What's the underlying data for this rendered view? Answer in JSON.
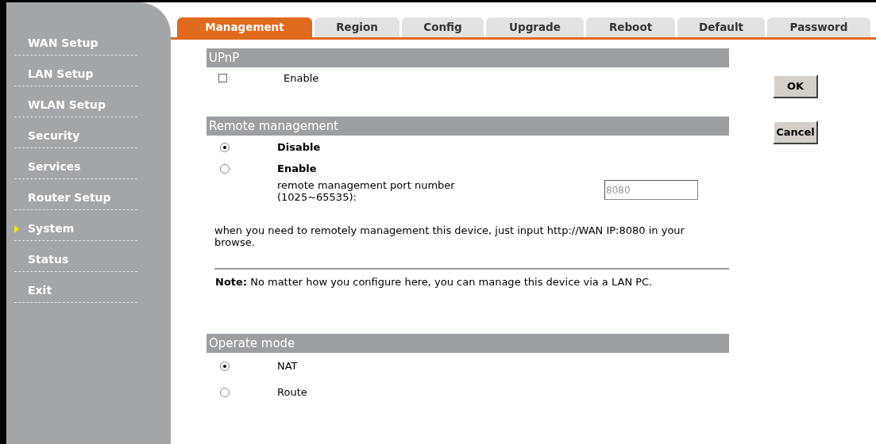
{
  "sidebar": {
    "items": [
      {
        "label": "WAN Setup",
        "selected": false
      },
      {
        "label": "LAN Setup",
        "selected": false
      },
      {
        "label": "WLAN Setup",
        "selected": false
      },
      {
        "label": "Security",
        "selected": false
      },
      {
        "label": "Services",
        "selected": false
      },
      {
        "label": "Router Setup",
        "selected": false
      },
      {
        "label": "System",
        "selected": true
      },
      {
        "label": "Status",
        "selected": false
      },
      {
        "label": "Exit",
        "selected": false
      }
    ]
  },
  "tabs": [
    {
      "label": "Management",
      "selected": true
    },
    {
      "label": "Region",
      "selected": false
    },
    {
      "label": "Config",
      "selected": false
    },
    {
      "label": "Upgrade",
      "selected": false
    },
    {
      "label": "Reboot",
      "selected": false
    },
    {
      "label": "Default",
      "selected": false
    },
    {
      "label": "Password",
      "selected": false
    }
  ],
  "upnp": {
    "title": "UPnP",
    "enable": {
      "label": "Enable",
      "checked": false
    }
  },
  "remote_management": {
    "title": "Remote management",
    "options": [
      {
        "label": "Disable",
        "selected": true
      },
      {
        "label": "Enable",
        "selected": false
      }
    ],
    "port_label": "remote management port number (1025~65535):",
    "port_value": "8080",
    "info": "when you need to remotely management this device, just input http://WAN IP:8080 in your browse.",
    "note": "**Note:** No matter how you configure here, you can manage this device via a LAN PC."
  },
  "operate_mode": {
    "title": "Operate mode",
    "options": [
      {
        "label": "NAT",
        "selected": true
      },
      {
        "label": "Route",
        "selected": false
      }
    ]
  },
  "buttons": [
    "OK",
    "Cancel"
  ]
}
